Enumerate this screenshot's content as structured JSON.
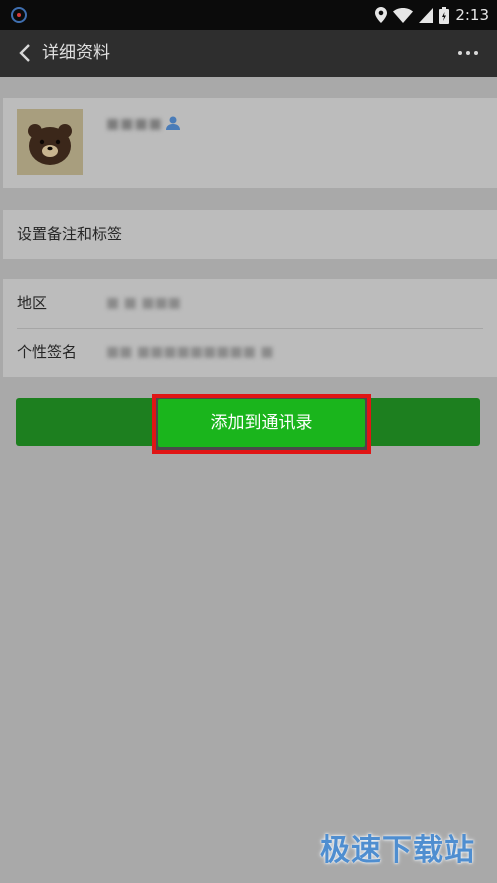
{
  "status_bar": {
    "time": "2:13"
  },
  "title_bar": {
    "title": "详细资料"
  },
  "profile": {
    "nickname": "■■■■"
  },
  "rows": {
    "remark_label": "设置备注和标签",
    "region_label": "地区",
    "region_value": "■ ■ ■■■",
    "signature_label": "个性签名",
    "signature_value": "■■ ■■■■■■■■■ ■"
  },
  "actions": {
    "add_to_contacts": "添加到通讯录"
  },
  "watermark": "极速下载站",
  "colors": {
    "primary_green": "#1ab51c",
    "highlight_red": "#e01515",
    "titlebar": "#2e2e2e",
    "watermark_blue": "#4f8ed0"
  }
}
